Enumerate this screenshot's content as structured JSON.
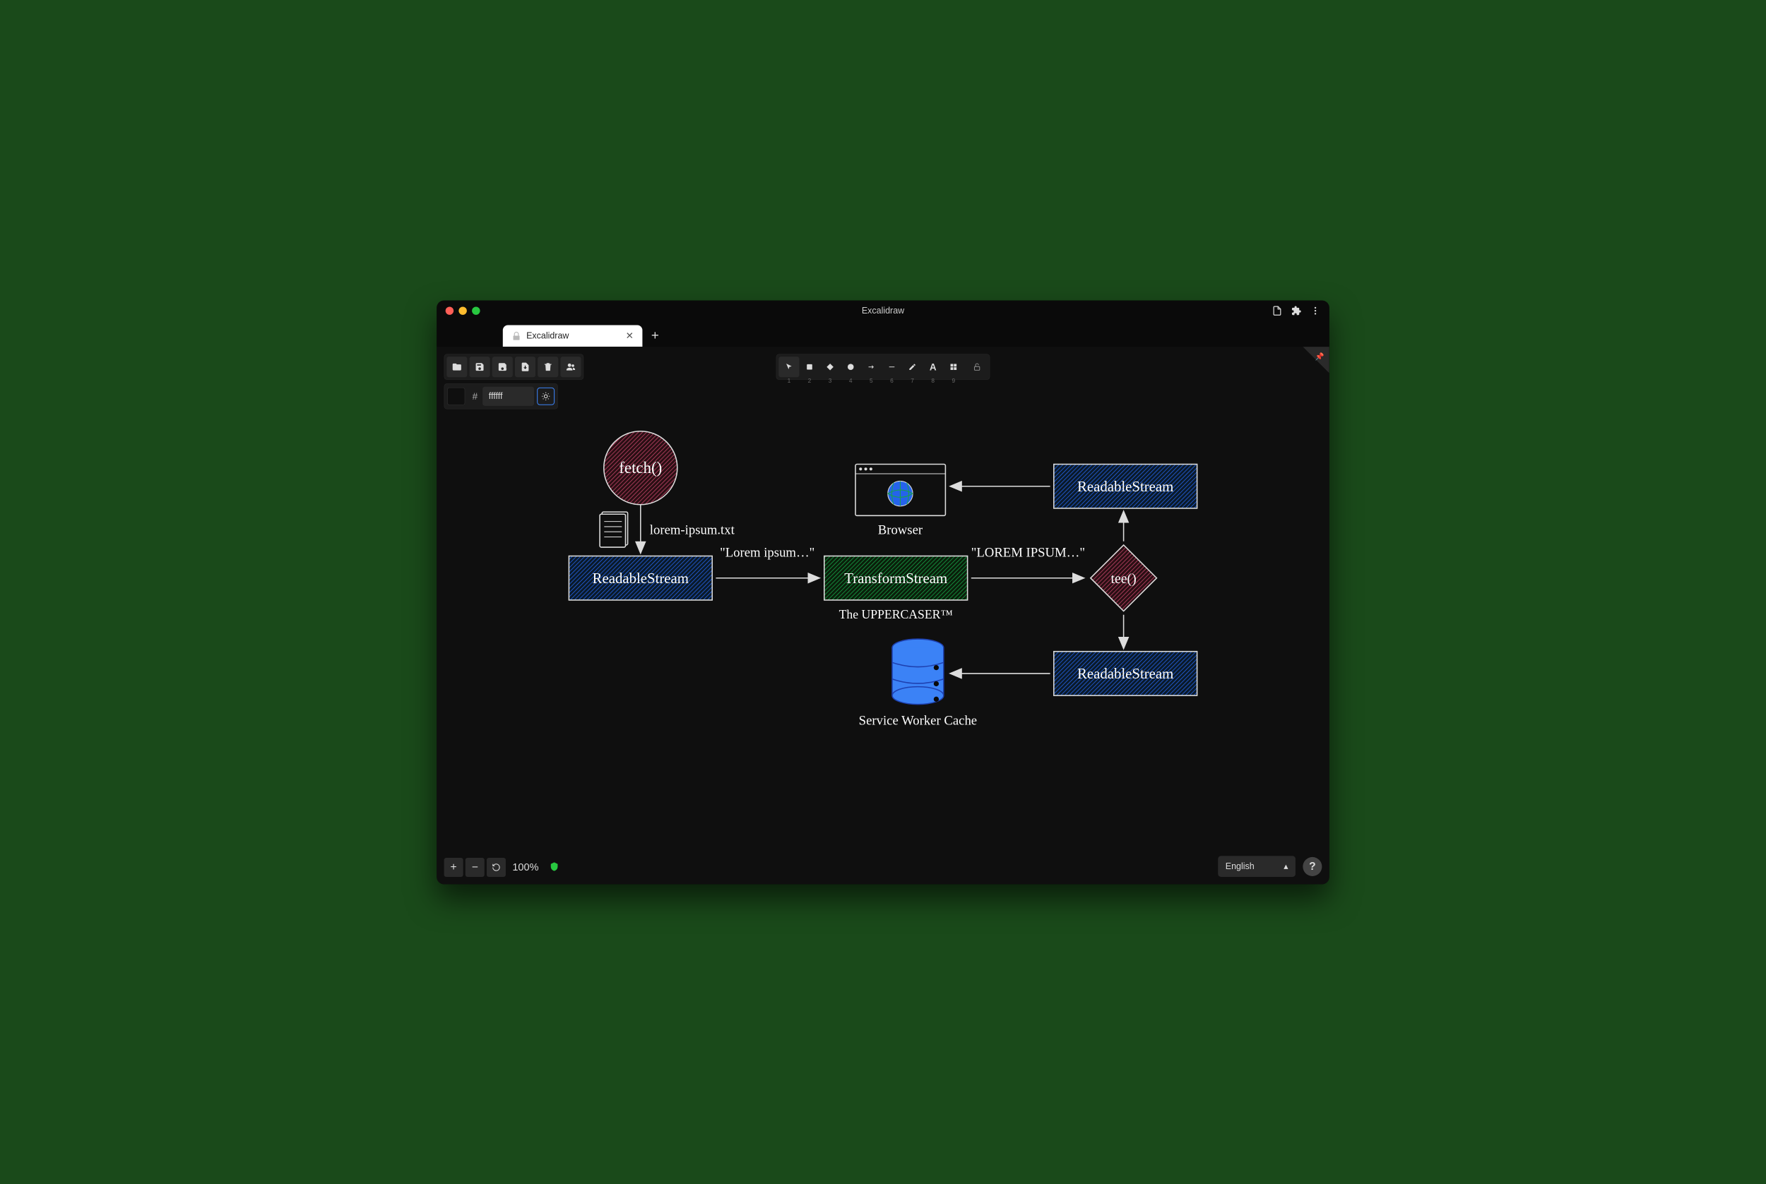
{
  "window": {
    "title": "Excalidraw"
  },
  "tab": {
    "label": "Excalidraw"
  },
  "color": {
    "value": "ffffff"
  },
  "tools": {
    "n1": "1",
    "n2": "2",
    "n3": "3",
    "n4": "4",
    "n5": "5",
    "n6": "6",
    "n7": "7",
    "n8": "8",
    "n9": "9"
  },
  "zoom": {
    "plus": "+",
    "minus": "−",
    "percent": "100%"
  },
  "language": {
    "selected": "English"
  },
  "help": {
    "label": "?"
  },
  "diagram": {
    "fetch": "fetch()",
    "file": "lorem-ipsum.txt",
    "readable1": "ReadableStream",
    "lorem_lower": "\"Lorem ipsum…\"",
    "transform": "TransformStream",
    "transform_sub": "The UPPERCASER™",
    "lorem_upper": "\"LOREM IPSUM…\"",
    "tee": "tee()",
    "readable2": "ReadableStream",
    "browser": "Browser",
    "readable3": "ReadableStream",
    "cache": "Service Worker Cache"
  }
}
